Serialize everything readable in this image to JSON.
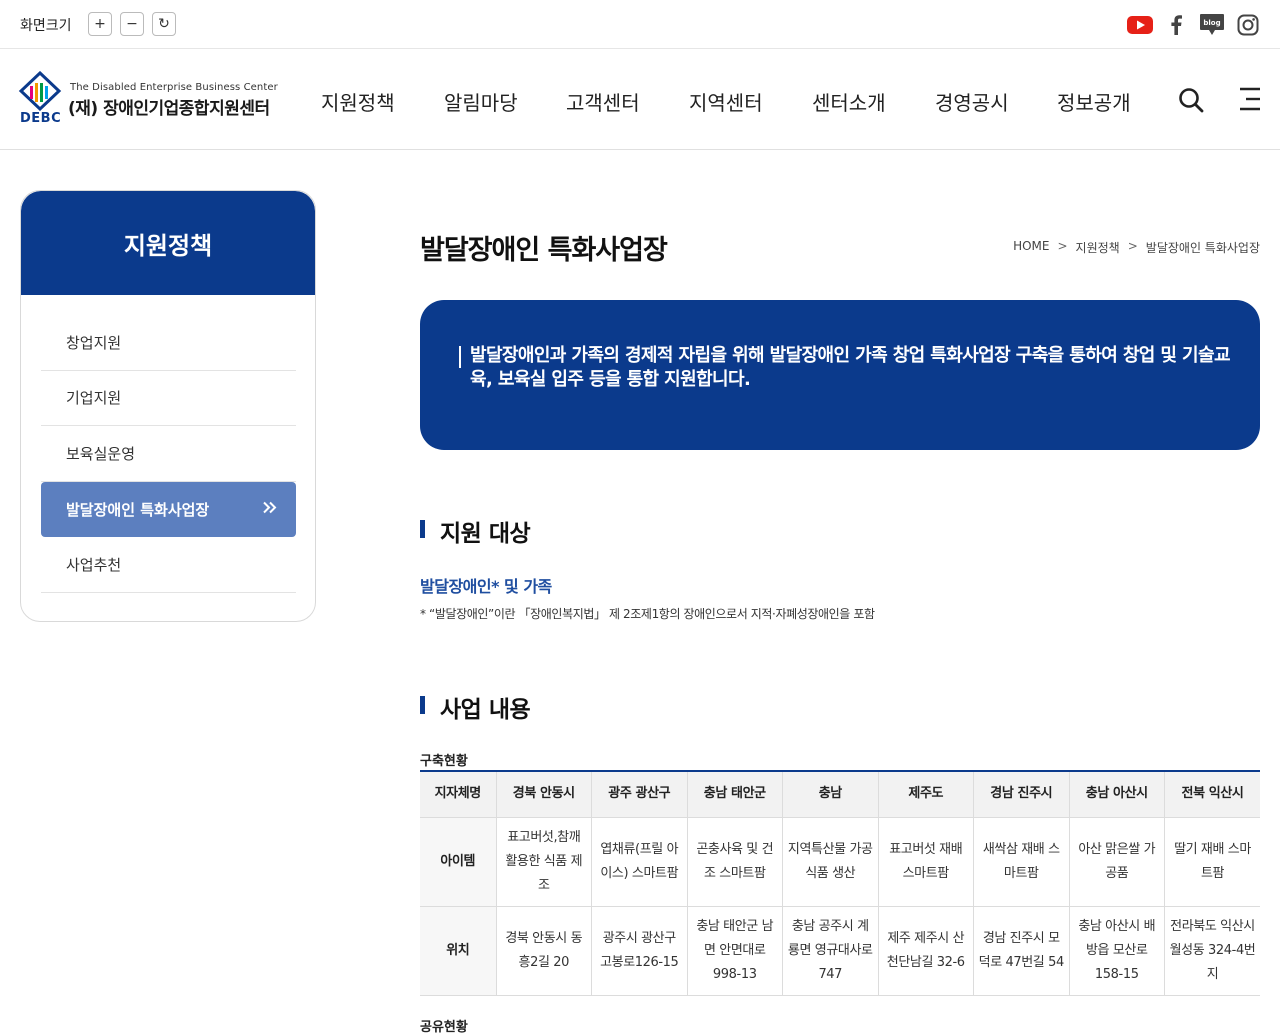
{
  "util": {
    "zoom_label": "화면크기",
    "zoom_in": "+",
    "zoom_out": "−",
    "zoom_reset": "↻"
  },
  "social": [
    "youtube-icon",
    "facebook-icon",
    "blog-icon",
    "instagram-icon"
  ],
  "logo": {
    "en": "The Disabled Enterprise Business Center",
    "ko": "(재) 장애인기업종합지원센터",
    "abbr": "DEBC"
  },
  "gnb": [
    "지원정책",
    "알림마당",
    "고객센터",
    "지역센터",
    "센터소개",
    "경영공시",
    "정보공개"
  ],
  "lnb": {
    "title": "지원정책",
    "items": [
      "창업지원",
      "기업지원",
      "보육실운영",
      "발달장애인 특화사업장",
      "사업추천"
    ],
    "active_index": 3
  },
  "page": {
    "title": "발달장애인 특화사업장",
    "breadcrumb": [
      "HOME",
      "지원정책",
      "발달장애인 특화사업장"
    ],
    "intro": "발달장애인과 가족의 경제적 자립을 위해 발달장애인 가족 창업 특화사업장 구축을 통하여 창업 및 기술교육, 보육실 입주 등을 통합 지원합니다."
  },
  "sections": {
    "target_title": "지원 대상",
    "target_sub": "발달장애인* 및 가족",
    "target_note": "* “발달장애인”이란 「장애인복지법」 제 2조제1항의 장애인으로서 지적·자폐성장애인을 포함",
    "business_title": "사업 내용",
    "table_caption": "구축현황",
    "next_caption": "공유현황"
  },
  "table": {
    "headers": [
      "지자체명",
      "경북 안동시",
      "광주 광산구",
      "충남 태안군",
      "충남",
      "제주도",
      "경남 진주시",
      "충남 아산시",
      "전북 익산시"
    ],
    "item_label": "아이템",
    "items": [
      "표고버섯,참깨 활용한 식품 제조",
      "엽채류(프릴 아이스) 스마트팜",
      "곤충사육 및 건조 스마트팜",
      "지역특산물 가공식품 생산",
      "표고버섯 재배 스마트팜",
      "새싹삼 재배 스마트팜",
      "아산 맑은쌀 가공품",
      "딸기 재배 스마트팜"
    ],
    "location_label": "위치",
    "locations": [
      "경북 안동시 동흥2길 20",
      "광주시 광산구 고봉로126-15",
      "충남 태안군 남면 안면대로 998-13",
      "충남 공주시 계룡면 영규대사로 747",
      "제주 제주시 산천단남길 32-6",
      "경남 진주시 모덕로 47번길 54",
      "충남 아산시 배방읍 모산로 158-15",
      "전라북도 익산시 월성동 324-4번지"
    ]
  },
  "colors": {
    "primary": "#0b3a8c",
    "active_menu": "#5c7fbf",
    "youtube": "#e62117"
  }
}
